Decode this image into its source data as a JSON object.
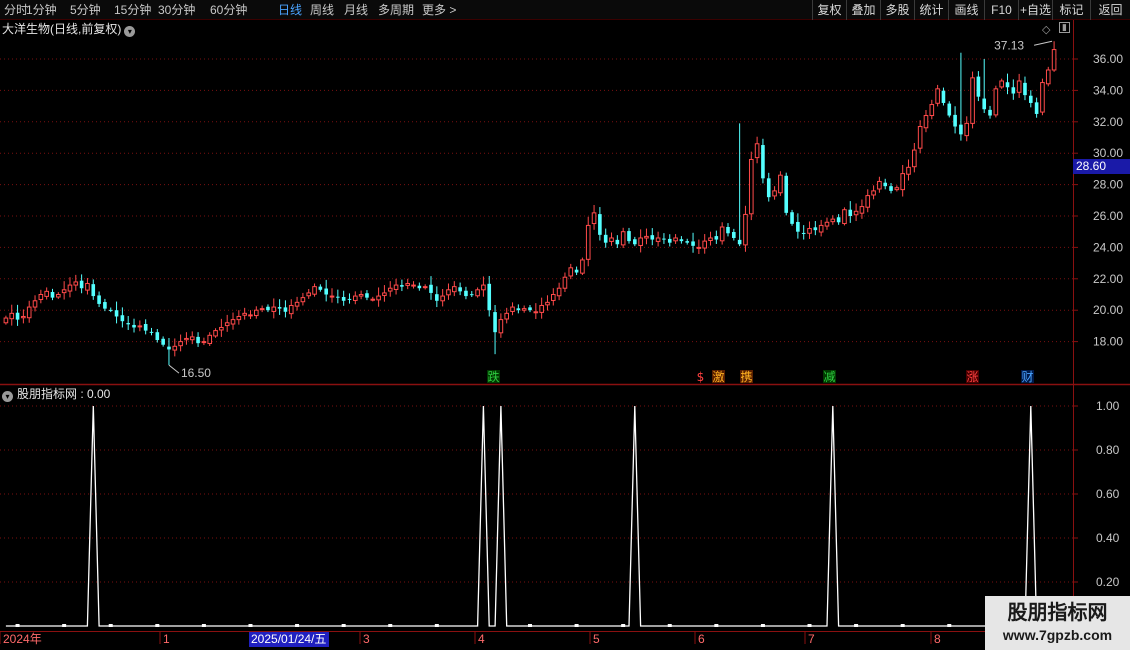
{
  "toolbar": {
    "periods": [
      {
        "label": "分时",
        "active": false
      },
      {
        "label": "1分钟",
        "active": false
      },
      {
        "label": "5分钟",
        "active": false
      },
      {
        "label": "15分钟",
        "active": false
      },
      {
        "label": "30分钟",
        "active": false
      },
      {
        "label": "60分钟",
        "active": false
      },
      {
        "label": "日线",
        "active": true
      },
      {
        "label": "周线",
        "active": false
      },
      {
        "label": "月线",
        "active": false
      },
      {
        "label": "多周期",
        "active": false
      },
      {
        "label": "更多 >",
        "active": false
      }
    ],
    "buttons": [
      "复权",
      "叠加",
      "多股",
      "统计",
      "画线",
      "F10",
      "+自选",
      "标记",
      "返回"
    ]
  },
  "main_chart": {
    "title": "大洋生物(日线,前复权)",
    "high_label": "37.13",
    "low_label": "16.50",
    "current_price": "28.60",
    "price_axis": [
      "36.00",
      "34.00",
      "32.00",
      "30.00",
      "28.00",
      "26.00",
      "24.00",
      "22.00",
      "20.00",
      "18.00"
    ],
    "markers": [
      {
        "text": "跌",
        "color": "#2ecc40",
        "bg": "#003a00"
      },
      {
        "text": "$",
        "color": "#ff4040",
        "bg": "#000000"
      },
      {
        "text": "激",
        "color": "#ffb020",
        "bg": "#5a2000"
      },
      {
        "text": "携",
        "color": "#ffb020",
        "bg": "#5a2000"
      },
      {
        "text": "减",
        "color": "#2ecc40",
        "bg": "#003a00"
      },
      {
        "text": "涨",
        "color": "#ff4040",
        "bg": "#4a0000"
      },
      {
        "text": "财",
        "color": "#4aa3ff",
        "bg": "#001a4a"
      }
    ]
  },
  "indicator": {
    "title": "股朋指标网 : 0.00",
    "axis": [
      "1.00",
      "0.80",
      "0.60",
      "0.40",
      "0.20"
    ]
  },
  "time_axis": {
    "labels": [
      "2024年",
      "1",
      "2025/01/24/五",
      "3",
      "4",
      "5",
      "6",
      "7",
      "8"
    ],
    "selected": "2025/01/24/五"
  },
  "watermark": {
    "line1": "股朋指标网",
    "line2": "www.7gpzb.com"
  },
  "colors": {
    "up": "#ff4a4a",
    "down": "#54ffff",
    "grid": "#7a1010",
    "border": "#8a1010",
    "active_tab": "#4aa3ff",
    "price_tag": "#1a1aa8"
  },
  "chart_data": {
    "type": "candlestick",
    "title": "大洋生物(日线,前复权)",
    "x_range": [
      "2024-12",
      "2025-08"
    ],
    "ylim": [
      16.5,
      37.13
    ],
    "y_ticks": [
      18,
      20,
      22,
      24,
      26,
      28,
      30,
      32,
      34,
      36
    ],
    "close": [
      19.5,
      19.8,
      19.4,
      19.6,
      20.2,
      20.6,
      21.0,
      21.2,
      20.8,
      21.0,
      21.3,
      21.6,
      21.8,
      21.4,
      21.7,
      20.9,
      20.4,
      20.1,
      20.0,
      19.6,
      19.3,
      19.1,
      18.9,
      19.0,
      18.7,
      18.6,
      18.1,
      17.8,
      17.5,
      17.7,
      18.0,
      18.2,
      18.3,
      17.9,
      18.0,
      18.4,
      18.7,
      18.9,
      19.2,
      19.4,
      19.6,
      19.8,
      19.7,
      20.0,
      20.1,
      20.0,
      20.2,
      20.1,
      19.9,
      20.3,
      20.5,
      20.8,
      21.1,
      21.5,
      21.3,
      21.0,
      20.9,
      20.8,
      20.6,
      20.7,
      20.9,
      21.0,
      20.8,
      20.7,
      20.9,
      21.1,
      21.4,
      21.6,
      21.5,
      21.7,
      21.6,
      21.4,
      21.5,
      21.1,
      20.6,
      20.9,
      21.3,
      21.5,
      21.2,
      20.9,
      21.0,
      21.3,
      21.6,
      20.0,
      18.6,
      19.4,
      19.8,
      20.2,
      20.0,
      20.1,
      20.0,
      19.9,
      20.3,
      20.5,
      21.0,
      21.4,
      22.1,
      22.7,
      22.4,
      23.2,
      25.4,
      26.2,
      24.8,
      24.3,
      24.6,
      24.2,
      25.0,
      24.4,
      24.2,
      24.6,
      24.7,
      24.5,
      24.6,
      24.5,
      24.3,
      24.6,
      24.4,
      24.3,
      24.1,
      24.0,
      24.4,
      24.6,
      24.5,
      25.3,
      24.9,
      24.6,
      24.2,
      26.1,
      29.6,
      30.6,
      28.4,
      27.2,
      27.6,
      28.6,
      26.2,
      25.5,
      25.0,
      24.9,
      25.2,
      25.1,
      25.4,
      25.6,
      25.8,
      25.6,
      26.4,
      26.0,
      26.3,
      26.6,
      27.3,
      27.6,
      28.2,
      27.9,
      27.6,
      27.8,
      28.7,
      29.1,
      30.2,
      31.7,
      32.4,
      33.1,
      34.1,
      33.2,
      32.4,
      31.7,
      31.2,
      31.9,
      34.8,
      33.6,
      32.8,
      32.4,
      34.1,
      34.6,
      34.2,
      33.8,
      34.6,
      33.7,
      33.2,
      32.5,
      34.5,
      35.3,
      36.6
    ],
    "y_high_marked": 37.13,
    "y_low_marked": 16.5,
    "current_price": 28.6,
    "indicator": {
      "name": "股朋指标网",
      "value_range": [
        0,
        1
      ],
      "spikes_at_index": [
        15,
        82,
        85,
        108,
        142,
        176
      ],
      "spike_value": 1.0
    }
  }
}
